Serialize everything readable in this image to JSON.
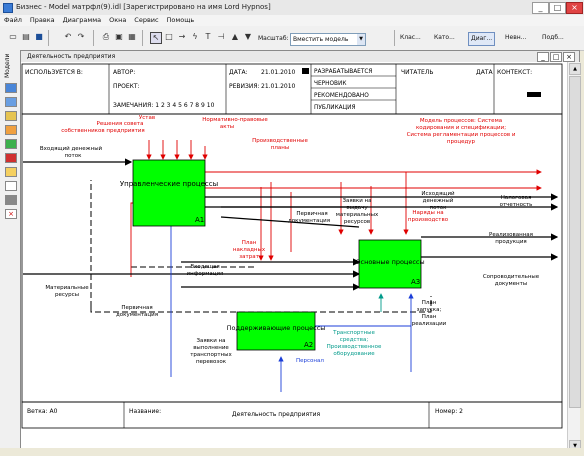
{
  "window": {
    "title": "Бизнес - Model матрфл(9).idl [Зарегистрировано на имя Lord Hypnos]",
    "minimize": "_",
    "maximize": "□",
    "close": "×"
  },
  "menu": [
    "Файл",
    "Правка",
    "Диаграмма",
    "Окна",
    "Сервис",
    "Помощь"
  ],
  "toolbar": {
    "icons": [
      "new-icon",
      "open-icon",
      "save-icon",
      "print-icon",
      "undo-icon",
      "redo-icon",
      "pointer-icon",
      "box-icon",
      "arrow-icon",
      "squiggle-icon",
      "text-icon",
      "triangle-up-icon",
      "triangle-down-icon"
    ],
    "zoom_label": "Масштаб:",
    "fit_value": "Вместить модель",
    "tabs": [
      "Клас...",
      "Като...",
      "Диаг...",
      "Невн...",
      "Подб..."
    ]
  },
  "left_panel": {
    "label": "Модели"
  },
  "document": {
    "title": "Деятельность предприятия"
  },
  "header": {
    "used_in": "ИСПОЛЬЗУЕТСЯ В:",
    "author": "АВТОР:",
    "project": "ПРОЕКТ:",
    "notes": "ЗАМЕЧАНИЯ: 1 2 3 4 5 6 7 8 9 10",
    "date_label": "ДАТА:",
    "date_value": "21.01.2010",
    "revision_label": "РЕВИЗИЯ:",
    "revision_value": "21.01.2010",
    "status": [
      "РАЗРАБАТЫВАЕТСЯ",
      "ЧЕРНОВИК",
      "РЕКОМЕНДОВАНО",
      "ПУБЛИКАЦИЯ"
    ],
    "reader": "ЧИТАТЕЛЬ",
    "reader_date": "ДАТА",
    "context": "КОНТЕКСТ:"
  },
  "diagram": {
    "boxes": [
      {
        "name": "Управленческие процессы",
        "num": "A1"
      },
      {
        "name": "Основные процессы",
        "num": "A3"
      },
      {
        "name": "Поддерживающие процессы",
        "num": "A2"
      }
    ],
    "labels": {
      "ustav": "Устав",
      "reshenia": "Решения совета",
      "sobstvennikov": "собственников предприятия",
      "normativnye1": "Нормативно-правовые",
      "normativnye2": "акты",
      "proizv1": "Производственные",
      "proizv2": "планы",
      "model1": "Модель процессов: Система",
      "model2": "кодирования и спецификации;",
      "model3": "Система регламентации процессов и",
      "model4": "процедур",
      "vhod1": "Входящий денежный",
      "vhod2": "поток",
      "ishod1": "Исходящий",
      "ishod2": "денежный",
      "ishod3": "поток",
      "nalog1": "Налоговая",
      "nalog2": "отчетность",
      "pervich_doc1": "Первичная",
      "pervich_doc2": "документация",
      "zayavki_vydachu1": "Заявки на",
      "zayavki_vydachu2": "выдачу",
      "zayavki_vydachu3": "материальных",
      "zayavki_vydachu4": "ресурсов",
      "naryady1": "Наряды на",
      "naryady2": "производство",
      "realiz1": "Реализованная",
      "realiz2": "продукция",
      "soprovod1": "Сопроводительные",
      "soprovod2": "документы",
      "plan_zatrat1": "План",
      "plan_zatrat2": "накладных",
      "plan_zatrat3": "затрат",
      "vhod_info1": "Входящая",
      "vhod_info2": "информация",
      "mat_res1": "Материальные",
      "mat_res2": "ресурсы",
      "perv_doc_bottom1": "Первичная",
      "perv_doc_bottom2": "документация",
      "zayavki_transport1": "Заявки на",
      "zayavki_transport2": "выполнение",
      "zayavki_transport3": "транспортных",
      "zayavki_transport4": "перевозок",
      "personal": "Персонал",
      "transport1": "Транспортные",
      "transport2": "средства;",
      "transport3": "Производственное",
      "transport4": "оборудование",
      "plan_zapusk1": "План",
      "plan_zapusk2": "запуска;",
      "plan_zapusk3": "План",
      "plan_zapusk4": "реализации"
    }
  },
  "footer": {
    "node": "Ветка: A0",
    "name_label": "Название:",
    "name_value": "Деятельность предприятия",
    "number": "Номер: 2"
  },
  "colors": {
    "box_fill": "#00ff00",
    "control_arrow": "#e00000",
    "mechanism_arrow": "#1b3ed8",
    "teal_arrow": "#009a8a",
    "black_arrow": "#000000"
  }
}
